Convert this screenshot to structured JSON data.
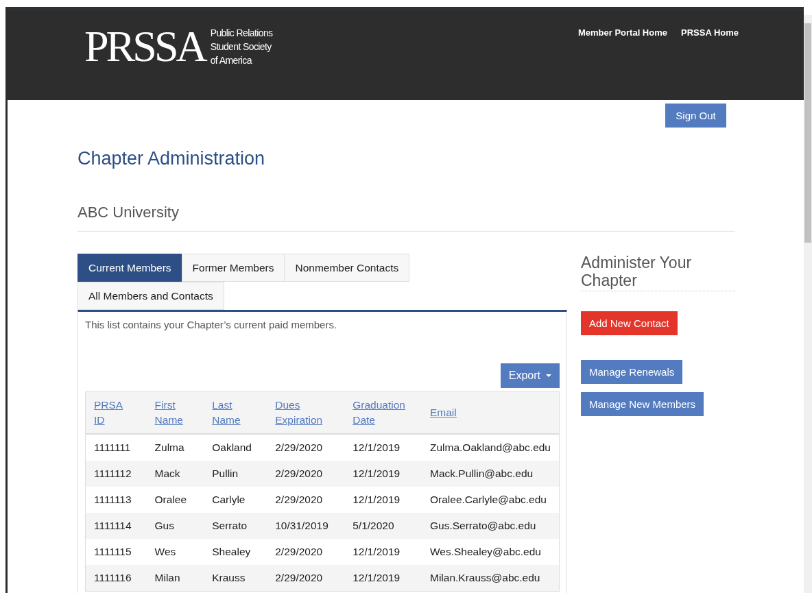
{
  "header": {
    "logo": "PRSSA",
    "tagline": [
      "Public Relations",
      "Student Society",
      "of America"
    ],
    "nav": [
      "Member Portal Home",
      "PRSSA Home"
    ]
  },
  "sign_out": "Sign Out",
  "title": "Chapter Administration",
  "chapter": "ABC University",
  "tabs": [
    {
      "label": "Current Members",
      "selected": true
    },
    {
      "label": "Former Members",
      "selected": false
    },
    {
      "label": "Nonmember Contacts",
      "selected": false
    },
    {
      "label": "All Members and Contacts",
      "selected": false
    }
  ],
  "description": "This list contains your Chapter’s current paid members.",
  "export": "Export",
  "table": {
    "columns": [
      "PRSA ID",
      "First Name",
      "Last Name",
      "Dues Expiration",
      "Graduation Date",
      "Email"
    ],
    "rows": [
      [
        "1111111",
        "Zulma",
        "Oakland",
        "2/29/2020",
        "12/1/2019",
        "Zulma.Oakland@abc.edu"
      ],
      [
        "1111112",
        "Mack",
        "Pullin",
        "2/29/2020",
        "12/1/2019",
        "Mack.Pullin@abc.edu"
      ],
      [
        "1111113",
        "Oralee",
        "Carlyle",
        "2/29/2020",
        "12/1/2019",
        "Oralee.Carlyle@abc.edu"
      ],
      [
        "1111114",
        "Gus",
        "Serrato",
        "10/31/2019",
        "5/1/2020",
        "Gus.Serrato@abc.edu"
      ],
      [
        "1111115",
        "Wes",
        "Shealey",
        "2/29/2020",
        "12/1/2019",
        "Wes.Shealey@abc.edu"
      ],
      [
        "1111116",
        "Milan",
        "Krauss",
        "2/29/2020",
        "12/1/2019",
        "Milan.Krauss@abc.edu"
      ]
    ]
  },
  "sidebar": {
    "title": "Administer Your Chapter",
    "buttons": [
      {
        "label": "Add New Contact",
        "kind": "primary"
      },
      {
        "label": "Manage Renewals",
        "kind": "secondary"
      },
      {
        "label": "Manage New Members",
        "kind": "secondary"
      }
    ]
  }
}
